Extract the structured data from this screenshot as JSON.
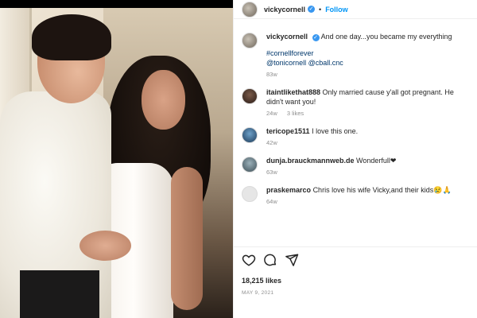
{
  "post": {
    "username": "vickycornell",
    "verified_mark": "✓",
    "separator": "•",
    "follow_label": "Follow"
  },
  "caption": {
    "username": "vickycornell",
    "text": "And one day...you became my everything",
    "hashtag": "#cornellforever",
    "mentions": "@tonicornell @cball.cnc",
    "time": "83w"
  },
  "comments": [
    {
      "username": "itaintlikethat888",
      "text": "Only married cause y'all got pregnant. He didn't want you!",
      "time": "24w",
      "likes": "3 likes",
      "avatar_icon": "user-avatar-icon"
    },
    {
      "username": "tericope1511",
      "text": "I love this one.",
      "time": "42w",
      "avatar_icon": "user-avatar-icon"
    },
    {
      "username": "dunja.brauckmannweb.de",
      "text": "Wonderfull❤",
      "time": "63w",
      "avatar_icon": "user-avatar-icon"
    },
    {
      "username": "praskemarco",
      "text": "Chris love his wife Vicky,and their kids😢🙏",
      "time": "64w",
      "avatar_icon": "default-avatar-icon"
    }
  ],
  "actions": {
    "like_icon": "heart-icon",
    "comment_icon": "comment-icon",
    "share_icon": "send-icon"
  },
  "likes_text": "18,215 likes",
  "date_text": "MAY 9, 2021",
  "colors": {
    "link": "#0095f6",
    "verified": "#3897f0",
    "muted": "#8e8e8e",
    "text": "#262626"
  }
}
